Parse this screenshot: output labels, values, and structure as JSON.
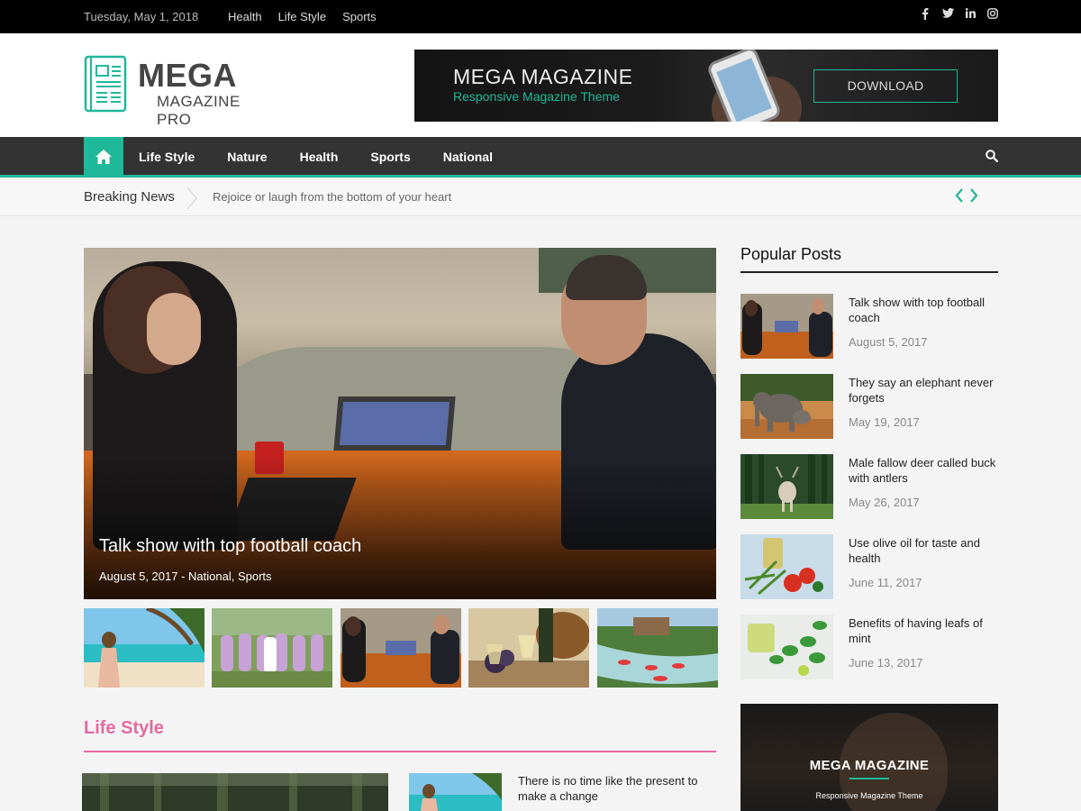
{
  "topbar": {
    "date": "Tuesday, May 1, 2018",
    "links": [
      "Health",
      "Life Style",
      "Sports"
    ],
    "social": [
      "facebook-icon",
      "twitter-icon",
      "linkedin-icon",
      "instagram-icon"
    ]
  },
  "logo": {
    "title": "MEGA",
    "subtitle": "MAGAZINE PRO"
  },
  "banner": {
    "title": "MEGA MAGAZINE",
    "subtitle": "Responsive Magazine Theme",
    "button": "DOWNLOAD"
  },
  "nav": {
    "items": [
      "Life Style",
      "Nature",
      "Health",
      "Sports",
      "National"
    ]
  },
  "breaking": {
    "label": "Breaking News",
    "text": "Rejoice or laugh from the bottom of your heart"
  },
  "hero": {
    "title": "Talk show with top football coach",
    "date": "August 5, 2017",
    "separator": " - ",
    "cat1": "National",
    "comma": ", ",
    "cat2": "Sports"
  },
  "lifestyle": {
    "heading": "Life Style",
    "post_title": "There is no time like the present to make a change"
  },
  "sidebar": {
    "heading": "Popular Posts",
    "posts": [
      {
        "title": "Talk show with top football coach",
        "date": "August 5, 2017"
      },
      {
        "title": "They say an elephant never forgets",
        "date": "May 19, 2017"
      },
      {
        "title": "Male fallow deer called buck with antlers",
        "date": "May 26, 2017"
      },
      {
        "title": "Use olive oil for taste and health",
        "date": "June 11, 2017"
      },
      {
        "title": "Benefits of having leafs of mint",
        "date": "June 13, 2017"
      }
    ],
    "banner_title": "MEGA MAGAZINE",
    "banner_subtitle": "Responsive Magazine Theme"
  },
  "colors": {
    "accent": "#1fb89a",
    "lifestyle": "#e46aa1",
    "nav_bg": "#333333",
    "topbar_bg": "#000000"
  }
}
